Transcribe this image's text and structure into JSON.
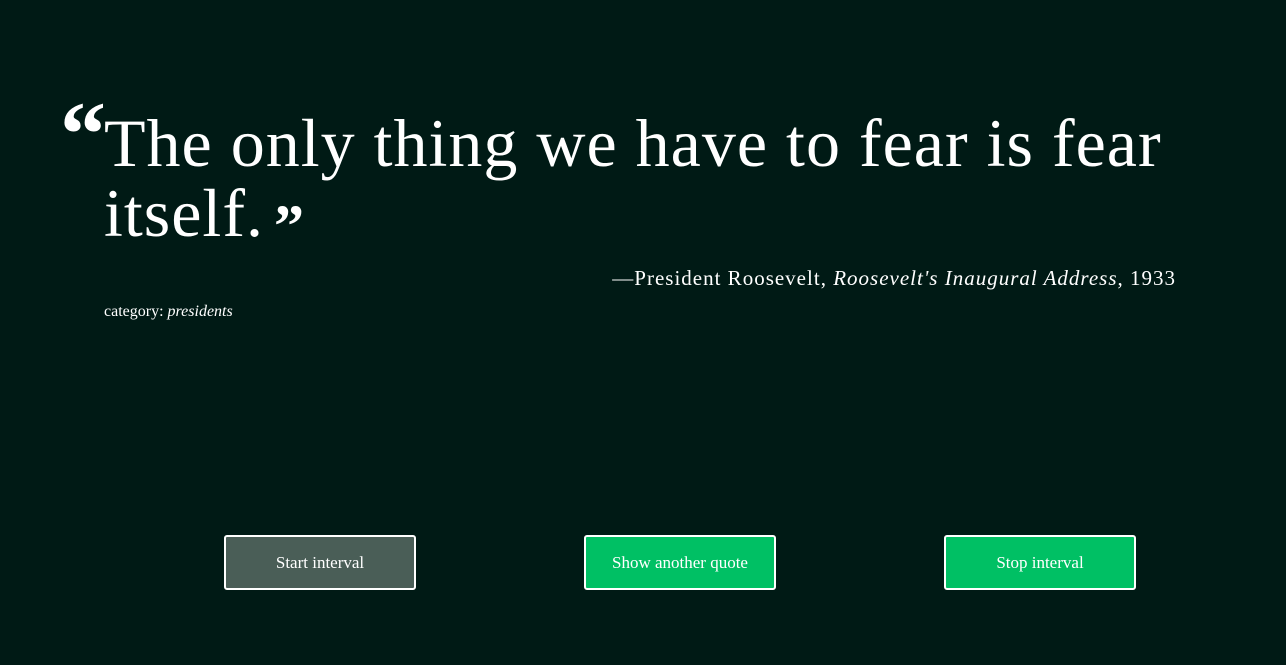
{
  "quote": {
    "open_mark": "“",
    "text": "The only thing we have to fear is fear itself.",
    "close_mark": "”"
  },
  "attribution": {
    "dash": "—",
    "author": "President Roosevelt",
    "separator": ", ",
    "source": "Roosevelt's Inaugural Address",
    "year_separator": ", ",
    "year": "1933"
  },
  "category": {
    "label": "category: ",
    "value": "presidents"
  },
  "buttons": {
    "start": "Start interval",
    "show": "Show another quote",
    "stop": "Stop interval"
  },
  "colors": {
    "background": "#001a15",
    "accent": "#00c064",
    "start_button": "#4a5e57"
  }
}
